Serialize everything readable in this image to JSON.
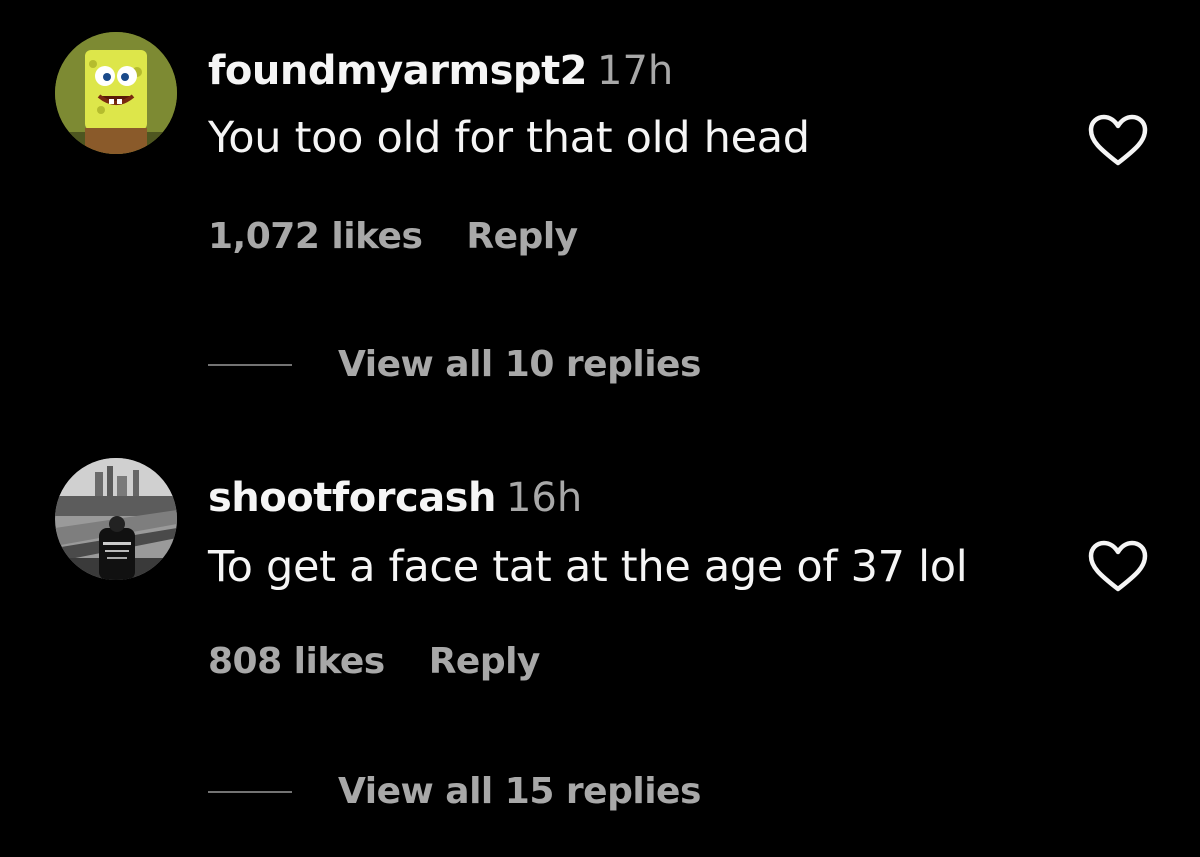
{
  "comments": [
    {
      "username": "foundmyarmspt2",
      "time": "17h",
      "text": "You too old for that old head",
      "likes": "1,072 likes",
      "reply_label": "Reply",
      "view_replies": "View all 10 replies",
      "avatar": "spongebob-avatar"
    },
    {
      "username": "shootforcash",
      "time": "16h",
      "text": "To get a face tat at the age of 37 lol",
      "likes": "808 likes",
      "reply_label": "Reply",
      "view_replies": "View all 15 replies",
      "avatar": "city-photo-avatar"
    }
  ],
  "colors": {
    "background": "#000000",
    "primary_text": "#f5f5f5",
    "secondary_text": "#a8a8a8",
    "divider": "#737373"
  },
  "icons": {
    "like": "heart-outline-icon"
  }
}
